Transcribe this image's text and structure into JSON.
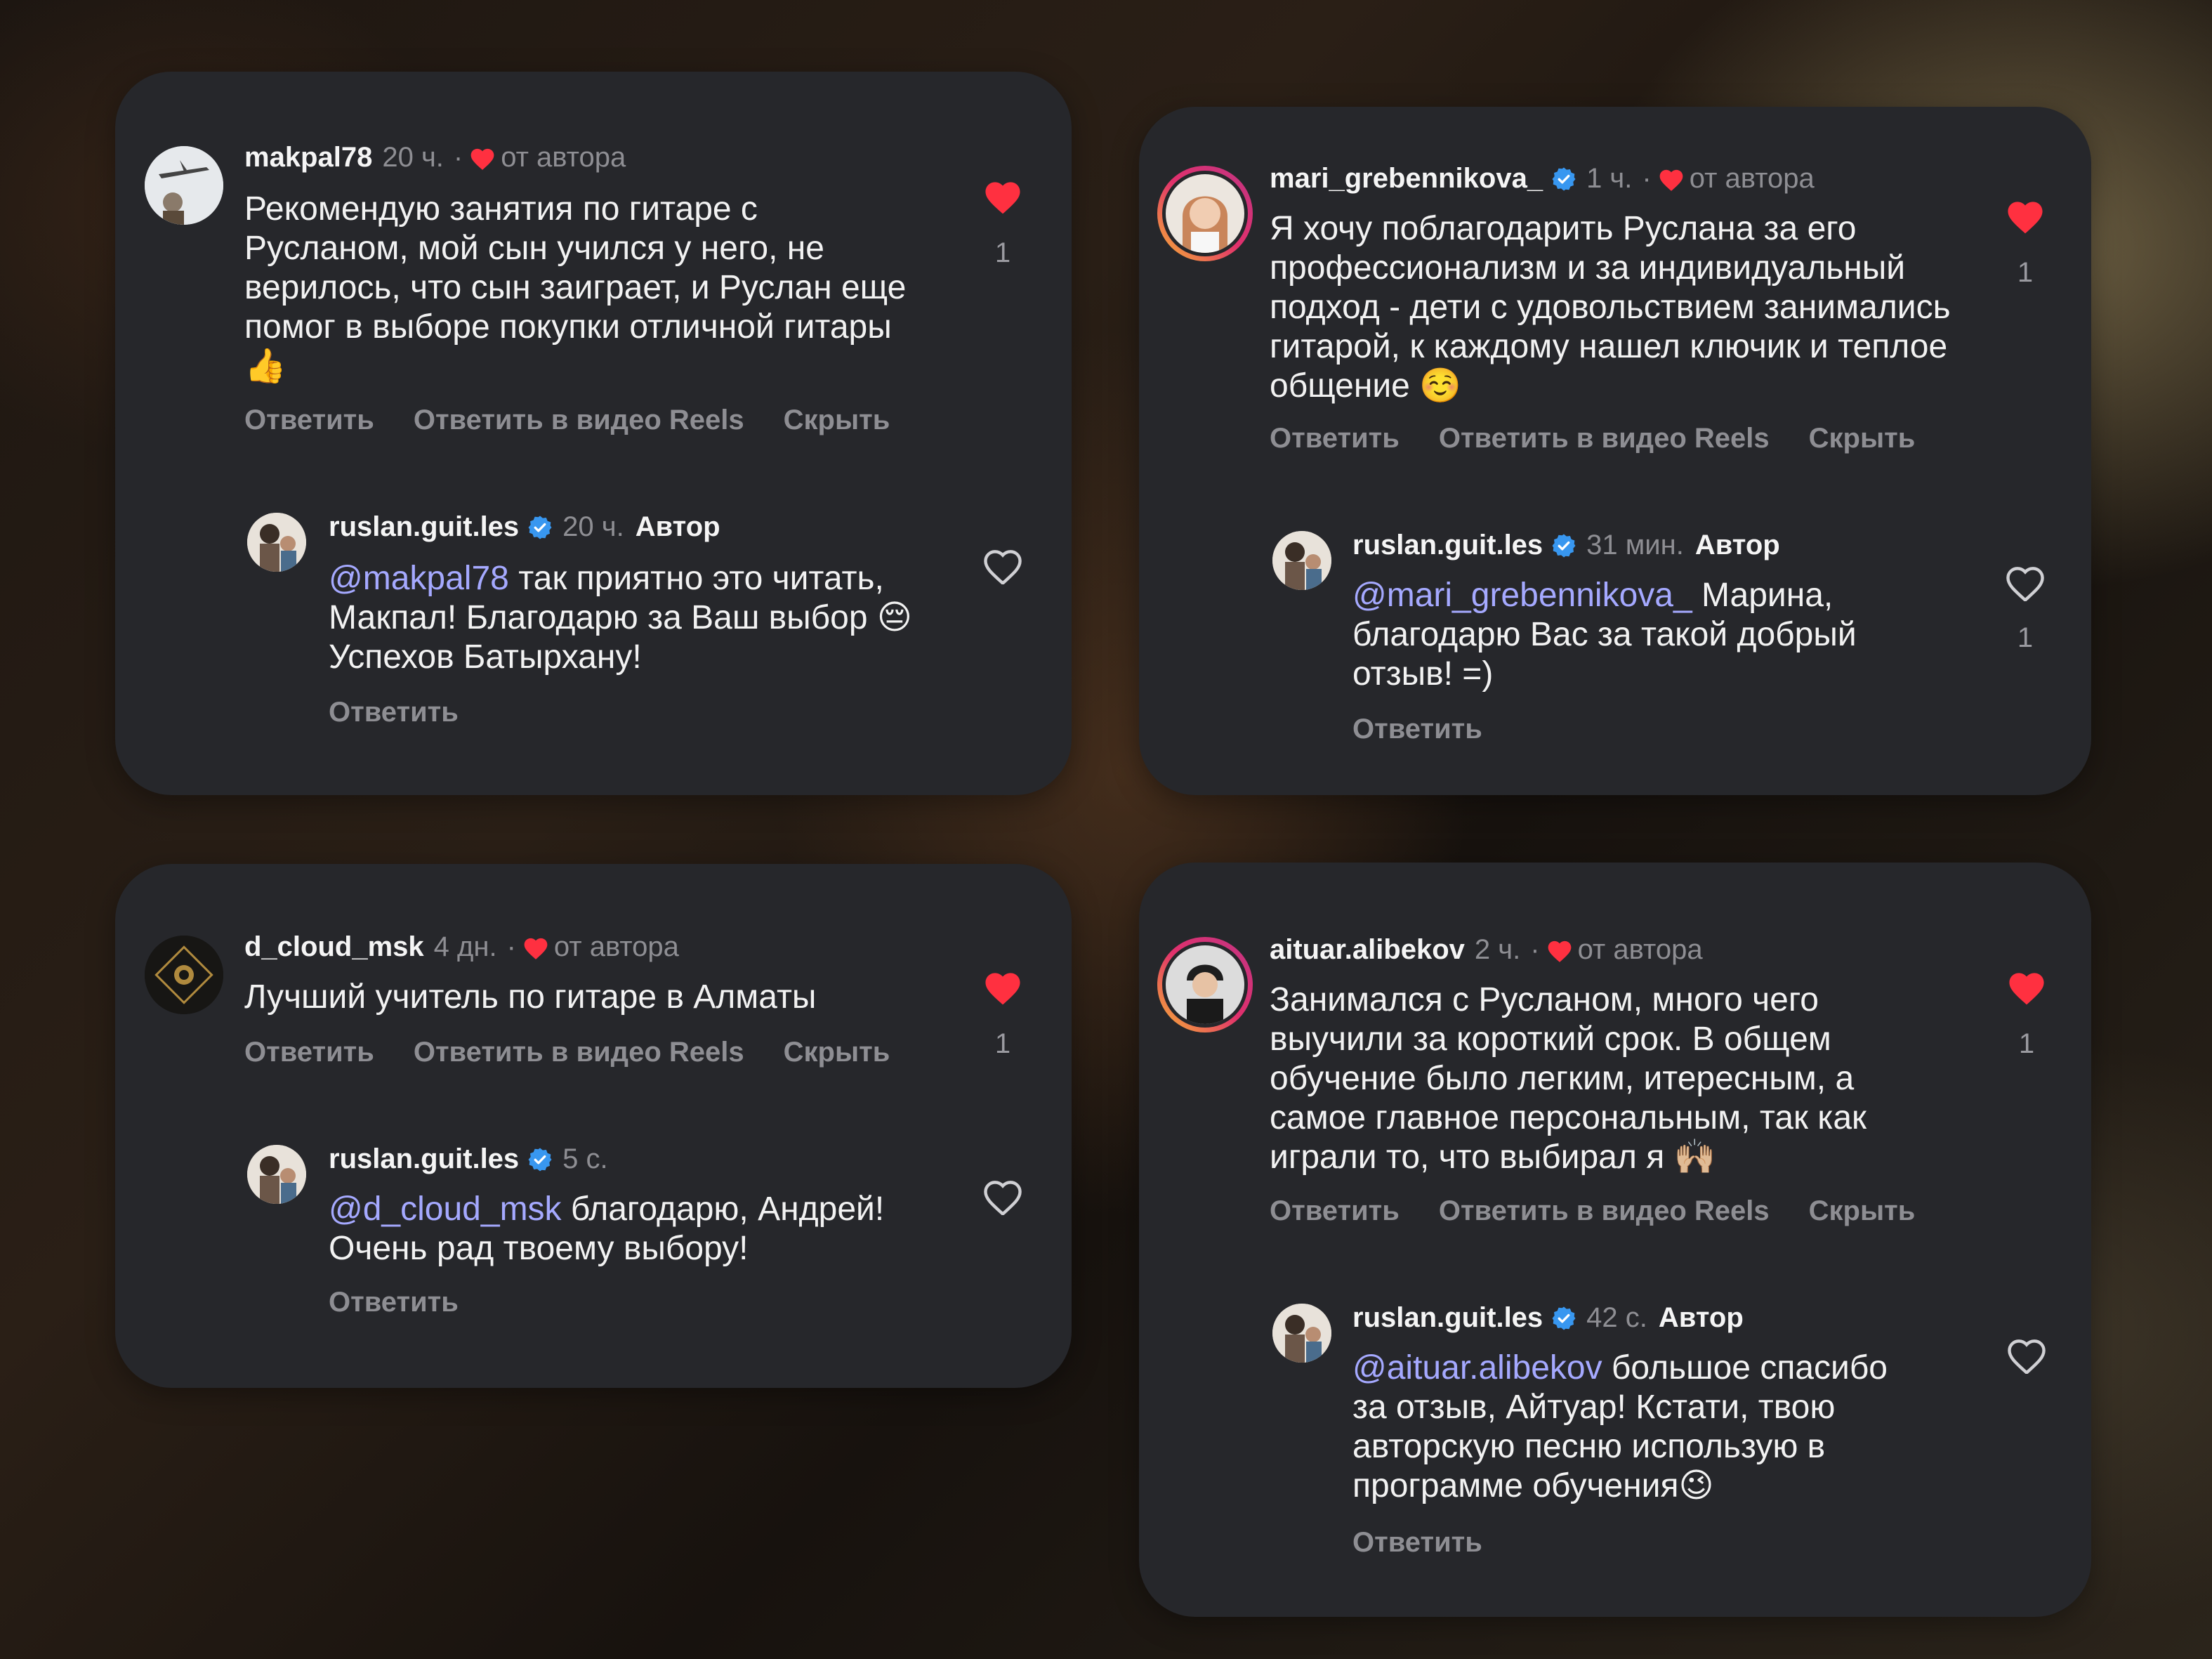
{
  "colors": {
    "card_bg": "#26272b",
    "like_red": "#ff3040",
    "mention": "#a5a9ff",
    "verified_blue": "#3897f0",
    "muted": "#8e8e93"
  },
  "comments": [
    {
      "username": "makpal78",
      "time": "20 ч.",
      "dot": "·",
      "liked_by": "от автора",
      "text": "Рекомендую занятия по гитаре с Русланом, мой сын учился у него, не верилось, что сын заиграет,  и Руслан еще помог в выборе покупки отличной гитары 👍",
      "likes": "1",
      "actions": [
        "Ответить",
        "Ответить в видео Reels",
        "Скрыть"
      ],
      "reply": {
        "username": "ruslan.guit.les",
        "time": "20 ч.",
        "author": "Автор",
        "mention": "@makpal78",
        "text": " так приятно это читать, Макпал! Благодарю за Ваш выбор 😔  Успехов Батырхану!",
        "likes": "",
        "action": "Ответить"
      }
    },
    {
      "username": "mari_grebennikova_",
      "time": "1 ч.",
      "dot": "·",
      "liked_by": "от автора",
      "text": "Я хочу поблагодарить Руслана за его профессионализм и за индивидуальный подход - дети с удовольствием занимались гитарой, к каждому нашел ключик и теплое общение ☺️",
      "likes": "1",
      "actions": [
        "Ответить",
        "Ответить в видео Reels",
        "Скрыть"
      ],
      "reply": {
        "username": "ruslan.guit.les",
        "time": "31 мин.",
        "author": "Автор",
        "mention": "@mari_grebennikova_",
        "text": " Марина, благодарю Вас за такой добрый отзыв! =)",
        "likes": "1",
        "action": "Ответить"
      }
    },
    {
      "username": "d_cloud_msk",
      "time": "4 дн.",
      "dot": "·",
      "liked_by": "от автора",
      "text": "Лучший учитель по гитаре в Алматы",
      "likes": "1",
      "actions": [
        "Ответить",
        "Ответить в видео Reels",
        "Скрыть"
      ],
      "reply": {
        "username": "ruslan.guit.les",
        "time": "5 с.",
        "author": "",
        "mention": "@d_cloud_msk",
        "text": " благодарю, Андрей! Очень рад твоему выбору!",
        "likes": "",
        "action": "Ответить"
      }
    },
    {
      "username": "aituar.alibekov",
      "time": "2 ч.",
      "dot": "·",
      "liked_by": "от автора",
      "text": "Занимался с Русланом, много чего выучили за короткий срок. В общем обучение было легким, итересным, а самое главное персональным, так как играли то, что выбирал я 🙌🏼",
      "likes": "1",
      "actions": [
        "Ответить",
        "Ответить в видео Reels",
        "Скрыть"
      ],
      "reply": {
        "username": "ruslan.guit.les",
        "time": "42 с.",
        "author": "Автор",
        "mention": "@aituar.alibekov",
        "text": " большое спасибо за отзыв, Айтуар! Кстати, твою авторскую песню использую в программе обучения😉",
        "likes": "",
        "action": "Ответить"
      }
    }
  ]
}
